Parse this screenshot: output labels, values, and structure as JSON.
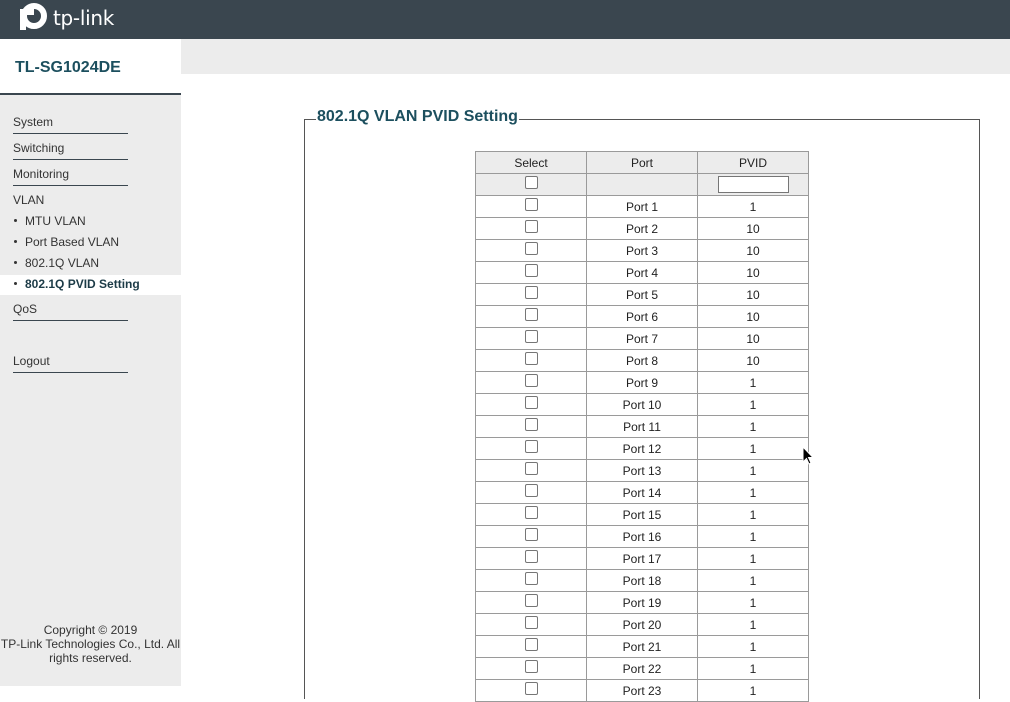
{
  "header": {
    "brand": "tp-link",
    "logo_icon": "tp-link-logo-icon"
  },
  "model": {
    "name": "TL-SG1024DE"
  },
  "menu": {
    "system": "System",
    "switching": "Switching",
    "monitoring": "Monitoring",
    "vlan": "VLAN",
    "vlan_items": [
      {
        "label": "MTU VLAN",
        "active": false
      },
      {
        "label": "Port Based VLAN",
        "active": false
      },
      {
        "label": "802.1Q VLAN",
        "active": false
      },
      {
        "label": "802.1Q PVID Setting",
        "active": true
      }
    ],
    "qos": "QoS",
    "logout": "Logout"
  },
  "copyright": {
    "line1": "Copyright © 2019",
    "line2": "TP-Link Technologies Co., Ltd. All",
    "line3": "rights reserved."
  },
  "panel": {
    "title": "802.1Q VLAN PVID Setting",
    "columns": [
      "Select",
      "Port",
      "PVID"
    ],
    "pvid_input_value": "",
    "rows": [
      {
        "port": "Port 1",
        "pvid": "1"
      },
      {
        "port": "Port 2",
        "pvid": "10"
      },
      {
        "port": "Port 3",
        "pvid": "10"
      },
      {
        "port": "Port 4",
        "pvid": "10"
      },
      {
        "port": "Port 5",
        "pvid": "10"
      },
      {
        "port": "Port 6",
        "pvid": "10"
      },
      {
        "port": "Port 7",
        "pvid": "10"
      },
      {
        "port": "Port 8",
        "pvid": "10"
      },
      {
        "port": "Port 9",
        "pvid": "1"
      },
      {
        "port": "Port 10",
        "pvid": "1"
      },
      {
        "port": "Port 11",
        "pvid": "1"
      },
      {
        "port": "Port 12",
        "pvid": "1"
      },
      {
        "port": "Port 13",
        "pvid": "1"
      },
      {
        "port": "Port 14",
        "pvid": "1"
      },
      {
        "port": "Port 15",
        "pvid": "1"
      },
      {
        "port": "Port 16",
        "pvid": "1"
      },
      {
        "port": "Port 17",
        "pvid": "1"
      },
      {
        "port": "Port 18",
        "pvid": "1"
      },
      {
        "port": "Port 19",
        "pvid": "1"
      },
      {
        "port": "Port 20",
        "pvid": "1"
      },
      {
        "port": "Port 21",
        "pvid": "1"
      },
      {
        "port": "Port 22",
        "pvid": "1"
      },
      {
        "port": "Port 23",
        "pvid": "1"
      }
    ]
  }
}
